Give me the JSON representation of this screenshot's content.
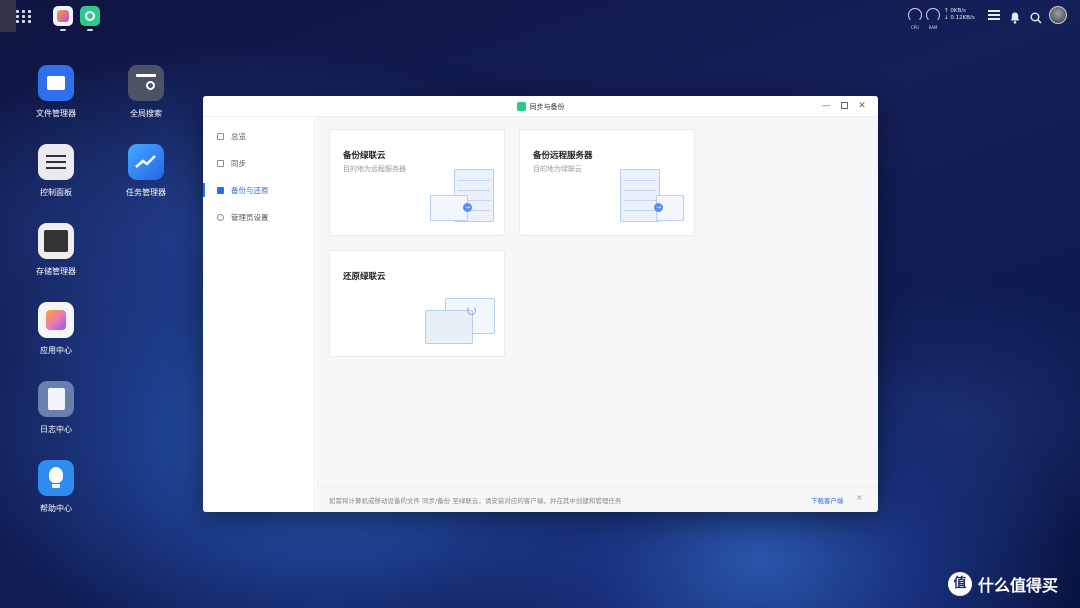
{
  "taskbar": {
    "net_up": "↑ 0KB/s",
    "net_down": "↓ 0.12KB/s",
    "cpu_label": "CPU",
    "ram_label": "RAM"
  },
  "desktop": {
    "icons": [
      {
        "label": "文件管理器",
        "icon": "folder-icon",
        "color": "#2f6ff0"
      },
      {
        "label": "全局搜索",
        "icon": "search-icon",
        "color": "#4d5366"
      },
      {
        "label": "控制面板",
        "icon": "sliders-icon",
        "color": "#e9ebef"
      },
      {
        "label": "任务管理器",
        "icon": "chart-icon",
        "color": "#3a8cf5"
      },
      {
        "label": "存储管理器",
        "icon": "storage-icon",
        "color": "#eeeeee"
      },
      {
        "label": "应用中心",
        "icon": "app-center-icon",
        "color": "#f5f5f5"
      },
      {
        "label": "日志中心",
        "icon": "log-icon",
        "color": "#6a7fb0"
      },
      {
        "label": "帮助中心",
        "icon": "lightbulb-icon",
        "color": "#2e8cf0"
      }
    ]
  },
  "window": {
    "title": "同步与备份",
    "sidebar": [
      {
        "label": "总览",
        "icon": "overview-icon",
        "active": false
      },
      {
        "label": "同步",
        "icon": "sync-icon",
        "active": false
      },
      {
        "label": "备份与还原",
        "icon": "backup-icon",
        "active": true
      },
      {
        "label": "管理员设置",
        "icon": "admin-settings-icon",
        "active": false
      }
    ],
    "cards": [
      {
        "title": "备份绿联云",
        "subtitle": "目的地为远程服务器"
      },
      {
        "title": "备份远程服务器",
        "subtitle": "目的地为绿联云"
      },
      {
        "title": "还原绿联云",
        "subtitle": ""
      }
    ],
    "footer": {
      "text": "如需将计算机或移动设备的文件 同步/备份 至绿联云，请安装对应的客户端，并在其中创建和管理任务",
      "link": "下载客户端",
      "close": "×"
    }
  },
  "watermark": {
    "logo": "值",
    "text": "什么值得买"
  },
  "colors": {
    "accent": "#2a6cf3",
    "sync_app": "#2fc98a"
  }
}
